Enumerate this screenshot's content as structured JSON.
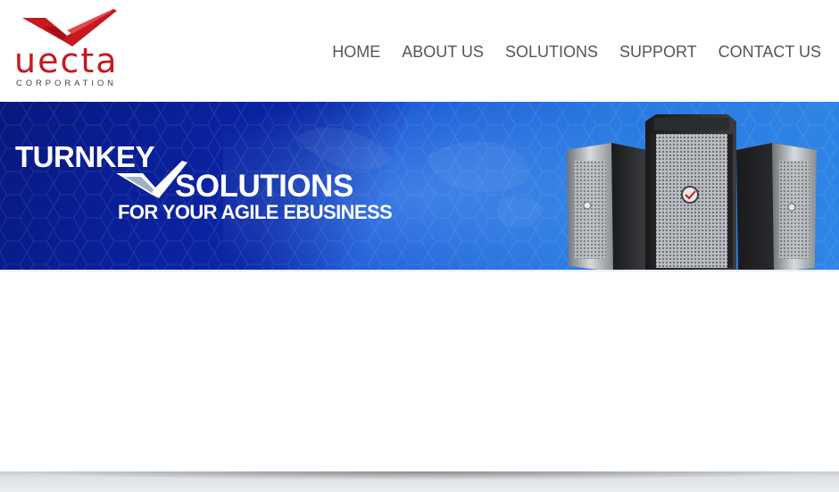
{
  "header": {
    "logo": {
      "wordmark": "uecta",
      "subtitle": "CORPORATION",
      "brand_color": "#c8171e"
    },
    "nav": [
      {
        "label": "HOME"
      },
      {
        "label": "ABOUT US"
      },
      {
        "label": "SOLUTIONS"
      },
      {
        "label": "SUPPORT"
      },
      {
        "label": "CONTACT US"
      }
    ]
  },
  "banner": {
    "line1": "TURNKEY",
    "line2": "SOLUTIONS",
    "line3": "FOR YOUR AGILE EBUSINESS",
    "primary_color": "#0d2aa8",
    "accent_color": "#2f86e6",
    "image": "server-towers"
  }
}
